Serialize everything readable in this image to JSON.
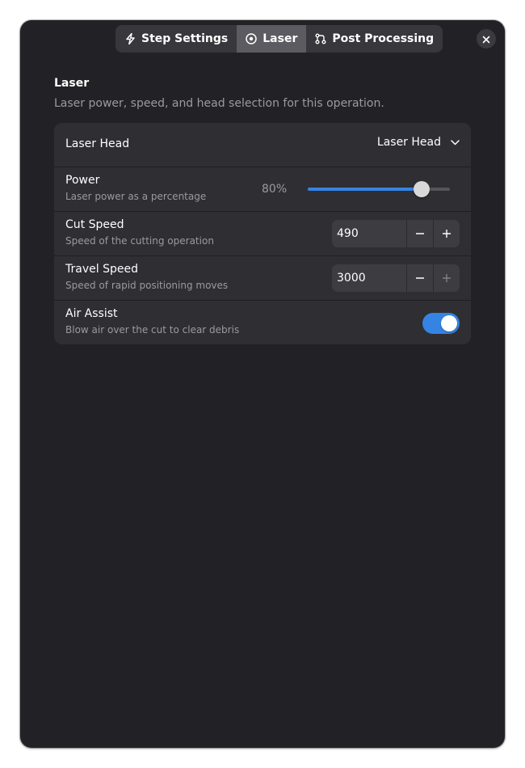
{
  "tabs": [
    {
      "label": "Step Settings",
      "icon": "lightning-icon"
    },
    {
      "label": "Laser",
      "icon": "laser-target-icon",
      "active": true
    },
    {
      "label": "Post Processing",
      "icon": "post-processing-icon"
    }
  ],
  "section": {
    "title": "Laser",
    "description": "Laser power, speed, and head selection for this operation."
  },
  "rows": {
    "laser_head": {
      "title": "Laser Head",
      "selected": "Laser Head"
    },
    "power": {
      "title": "Power",
      "subtitle": "Laser power as a percentage",
      "value_label": "80%",
      "value_fraction": 0.8
    },
    "cut_speed": {
      "title": "Cut Speed",
      "subtitle": "Speed of the cutting operation",
      "value": "490"
    },
    "travel_speed": {
      "title": "Travel Speed",
      "subtitle": "Speed of rapid positioning moves",
      "value": "3000"
    },
    "air_assist": {
      "title": "Air Assist",
      "subtitle": "Blow air over the cut to clear debris",
      "enabled": true
    }
  },
  "colors": {
    "accent": "#3584e4",
    "window_bg": "#222226",
    "card_bg": "#2e2e33"
  }
}
